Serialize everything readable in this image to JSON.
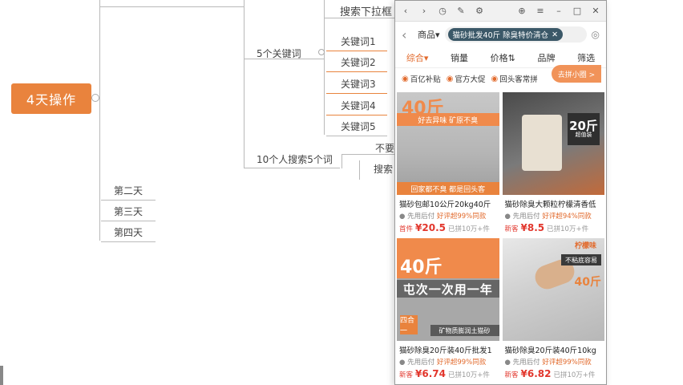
{
  "mindmap": {
    "root": "4天操作",
    "partial_node": "搜索下拉框",
    "keywords_group": "5个关键词",
    "keywords": [
      "关键词1",
      "关键词2",
      "关键词3",
      "关键词4",
      "关键词5"
    ],
    "search_group": "10个人搜索5个词",
    "sub_node_1": "不要",
    "sub_node_2": "搜索",
    "days": [
      "第二天",
      "第三天",
      "第四天"
    ]
  },
  "phone": {
    "titlebar_icons": [
      "chevron-left-icon",
      "chevron-right-icon",
      "refresh-icon",
      "edit-icon",
      "settings-icon",
      "add-icon",
      "menu-icon",
      "minimize-icon",
      "maximize-icon",
      "close-icon"
    ],
    "category": "商品",
    "search_chip": "猫砂批发40斤 除臭特价清仓",
    "sort": [
      "综合",
      "销量",
      "价格",
      "品牌",
      "筛选"
    ],
    "promos": [
      "百亿补贴",
      "官方大促",
      "回头客常拼"
    ],
    "float_button": "去拼小圈 >",
    "products": [
      {
        "title": "猫砂包邮10公斤20kg40斤",
        "sub_prefix": "先用后付",
        "sub_good": "好评超99%同款",
        "price_prefix": "首件",
        "price": "¥20.5",
        "sold": "已拼10万+件",
        "img_big": "40斤",
        "img_band": "好去异味 矿原不臭",
        "img_bottom": "回家都不臭 都是回头客"
      },
      {
        "title": "猫砂除臭大颗粒柠檬清香低",
        "sub_prefix": "先用后付",
        "sub_good": "好评超94%同款",
        "price_prefix": "新客",
        "price": "¥8.5",
        "sold": "已拼10万+件",
        "img_tag": "20斤",
        "img_tag_sub": "超值装"
      },
      {
        "title": "猫砂除臭20斤装40斤批发1",
        "sub_prefix": "先用后付",
        "sub_good": "好评超99%同款",
        "price_prefix": "新客",
        "price": "¥6.74",
        "sold": "已拼10万+件",
        "img_big": "40斤",
        "img_slogan": "屯次一次用一年",
        "img_foot": "矿物质膨润土猫砂",
        "img_badge": "四合一"
      },
      {
        "title": "猫砂除臭20斤装40斤10kg",
        "sub_prefix": "先用后付",
        "sub_good": "好评超99%同款",
        "price_prefix": "新客",
        "price": "¥6.82",
        "sold": "已拼10万+件",
        "img_top": "柠檬味",
        "img_label": "不粘底容易",
        "img_big": "40斤"
      }
    ]
  },
  "colors": {
    "accent": "#e9833d",
    "price": "#e2362c",
    "chip": "#3b5868"
  }
}
